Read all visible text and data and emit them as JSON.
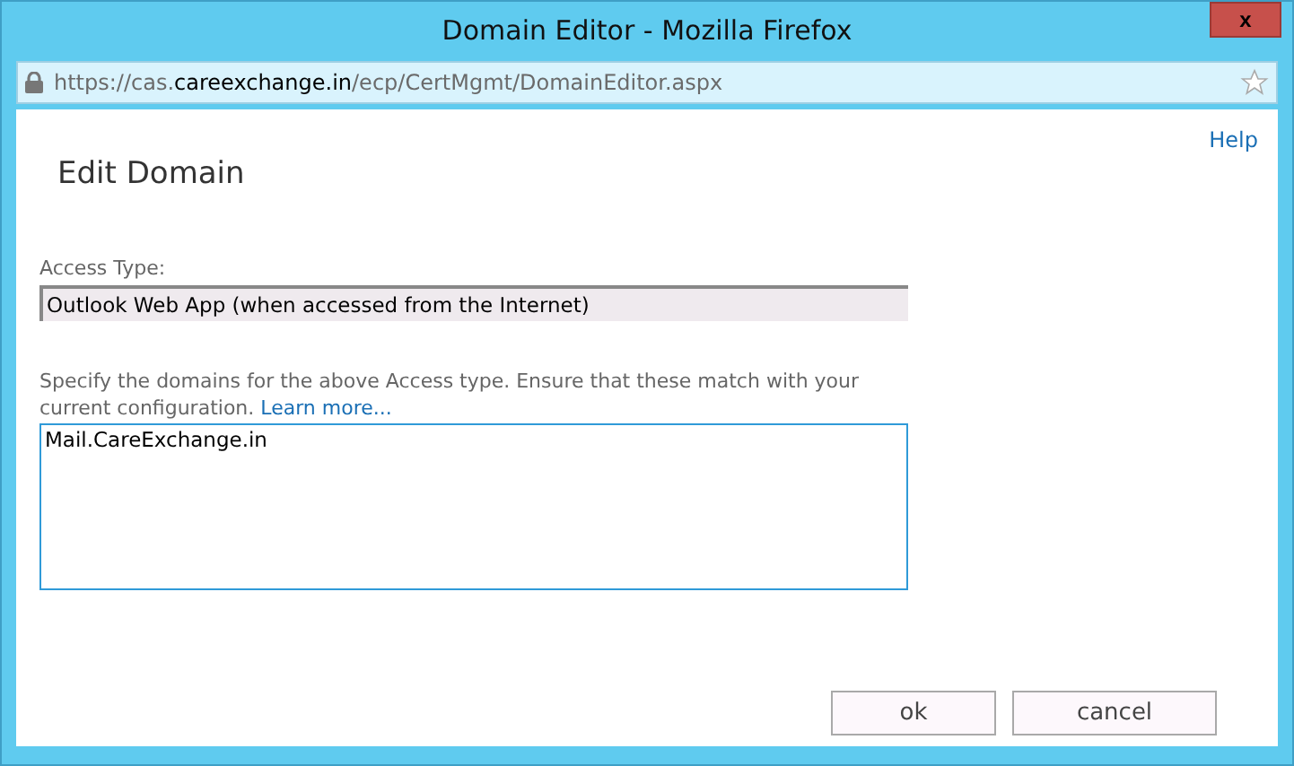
{
  "window": {
    "title": "Domain Editor - Mozilla Firefox",
    "close": "x"
  },
  "address_bar": {
    "url": "https://cas.**careexchange.in**/ecp/CertMgmt/DomainEditor.aspx"
  },
  "help_link": "Help",
  "heading": "Edit Domain",
  "access_type": {
    "label": "Access Type:",
    "value": "Outlook Web App (when accessed from the Internet)"
  },
  "domains": {
    "description": "Specify the domains for the above Access type. Ensure that these match with your current configuration.",
    "link": "Learn more...",
    "value": "Mail.CareExchange.in"
  },
  "buttons": [
    "ok",
    "cancel"
  ]
}
